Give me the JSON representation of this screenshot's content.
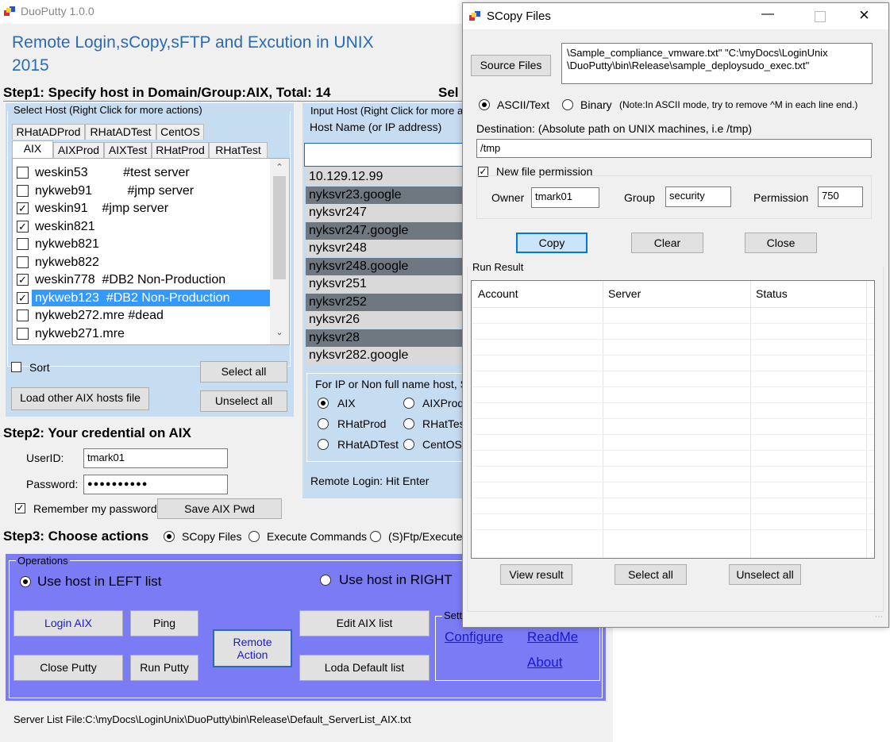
{
  "main": {
    "window_title": "DuoPutty 1.0.0",
    "heading_line1": "Remote Login,sCopy,sFTP and Excution in UNIX",
    "heading_line2": "2015",
    "step1": "Step1: Specify host in Domain/Group:AIX, Total: 14",
    "step1_right": "Sel",
    "select_host_group": "Select Host (Right Click for more actions)",
    "tabs_row1": [
      "RHatADProd",
      "RHatADTest",
      "CentOS"
    ],
    "tabs_row2": [
      "AIX",
      "AIXProd",
      "AIXTest",
      "RHatProd",
      "RHatTest"
    ],
    "hosts": [
      {
        "label": "weskin53          #test server",
        "checked": false,
        "selected": false
      },
      {
        "label": "nykweb91          #jmp server",
        "checked": false,
        "selected": false
      },
      {
        "label": "weskin91    #jmp server",
        "checked": true,
        "selected": false
      },
      {
        "label": "weskin821",
        "checked": true,
        "selected": false
      },
      {
        "label": "nykweb821",
        "checked": false,
        "selected": false
      },
      {
        "label": "nykweb822",
        "checked": false,
        "selected": false
      },
      {
        "label": "weskin778  #DB2 Non-Production",
        "checked": true,
        "selected": false
      },
      {
        "label": "nykweb123  #DB2 Non-Production",
        "checked": true,
        "selected": true
      },
      {
        "label": "nykweb272.mre #dead",
        "checked": false,
        "selected": false
      },
      {
        "label": "nykweb271.mre",
        "checked": false,
        "selected": false
      }
    ],
    "sort_label": "Sort",
    "select_all": "Select all",
    "load_other": "Load other AIX hosts file",
    "unselect_all": "Unselect all",
    "input_host_group": "Input Host (Right Click for more a",
    "host_name_label": "Host Name (or IP address)",
    "host_name_value": "",
    "right_hosts": [
      "10.129.12.99",
      "nyksvr23.google",
      "nyksvr247",
      "nyksvr247.google",
      "nyksvr248",
      "nyksvr248.google",
      "nyksvr251",
      "nyksvr252",
      "nyksvr26",
      "nyksvr28",
      "nyksvr282.google"
    ],
    "ip_group": "For IP or Non full name host, Se",
    "ip_radios": [
      {
        "label": "AIX",
        "on": true
      },
      {
        "label": "AIXProd",
        "on": false
      },
      {
        "label": "RHatProd",
        "on": false
      },
      {
        "label": "RHatTes",
        "on": false
      },
      {
        "label": "RHatADTest",
        "on": false
      },
      {
        "label": "CentOS",
        "on": false
      }
    ],
    "remote_login_hint": "Remote Login: Hit Enter",
    "step2": "Step2: Your credential on AIX",
    "userid_label": "UserID:",
    "userid_value": "tmark01",
    "password_label": "Password:",
    "password_value": "●●●●●●●●●●",
    "remember_label": "Remember my password",
    "save_pwd": "Save AIX Pwd",
    "step3": "Step3: Choose actions",
    "actions": [
      {
        "label": "SCopy Files",
        "on": true
      },
      {
        "label": "Execute Commands",
        "on": false
      },
      {
        "label": "(S)Ftp/Execute",
        "on": false
      }
    ],
    "operations_title": "Operations",
    "use_left": "Use host in LEFT list",
    "use_right": "Use host in RIGHT",
    "btn_login": "Login AIX",
    "btn_ping": "Ping",
    "btn_remote_action": "Remote Action",
    "btn_edit_list": "Edit AIX list",
    "btn_close_putty": "Close Putty",
    "btn_run_putty": "Run Putty",
    "btn_loda_default": "Loda Default list",
    "settings_title": "Sett",
    "link_configure": "Configure",
    "link_readme": "ReadMe",
    "link_about": "About",
    "server_list_file": "Server List File:C:\\myDocs\\LoginUnix\\DuoPutty\\bin\\Release\\Default_ServerList_AIX.txt"
  },
  "scopy": {
    "title": "SCopy Files",
    "source_btn": "Source Files",
    "source_value_line1": "\\Sample_compliance_vmware.txt\" \"C:\\myDocs\\LoginUnix",
    "source_value_line2": "\\DuoPutty\\bin\\Release\\sample_deploysudo_exec.txt\"",
    "mode_ascii": "ASCII/Text",
    "mode_binary": "Binary",
    "mode_note": "(Note:In ASCII mode, try to remove ^M in each line end.)",
    "dest_label": "Destination:  (Absolute path on UNIX machines, i.e  /tmp)",
    "dest_value": "/tmp",
    "newperm_label": "New file permission",
    "owner_label": "Owner",
    "owner_value": "tmark01",
    "group_label": "Group",
    "group_value": "security",
    "perm_label": "Permission",
    "perm_value": "750",
    "btn_copy": "Copy",
    "btn_clear": "Clear",
    "btn_close": "Close",
    "run_result": "Run Result",
    "columns": [
      "Account",
      "Server",
      "Status"
    ],
    "btn_view_result": "View result",
    "btn_select_all": "Select all",
    "btn_unselect_all": "Unselect all"
  },
  "colors": {
    "panel_blue": "#c6dcf1",
    "operations_purple": "#7b7bf5",
    "selected_row": "#3399ff",
    "dark_row": "#6f7880"
  }
}
